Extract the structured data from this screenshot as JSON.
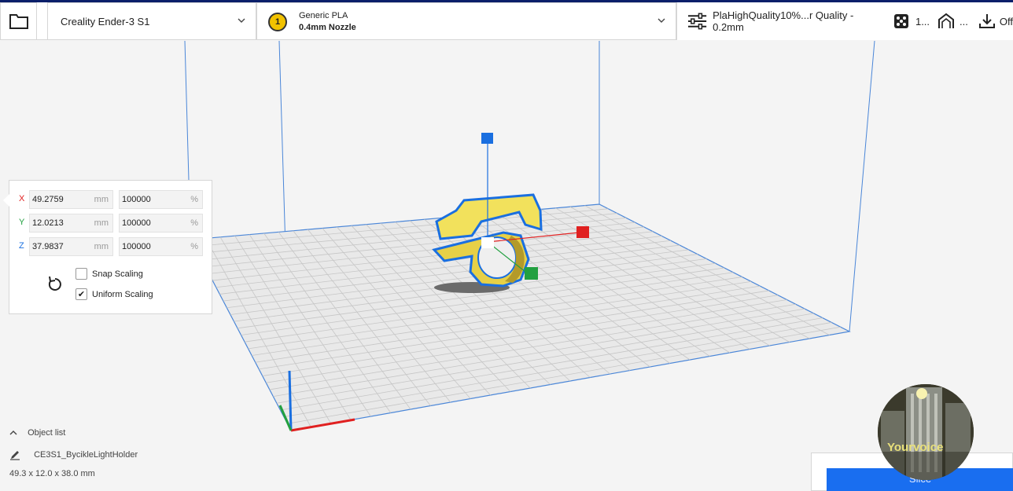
{
  "toolbar": {
    "printer_name": "Creality Ender-3 S1",
    "material": {
      "extruder_number": "1",
      "name": "Generic PLA",
      "nozzle": "0.4mm Nozzle"
    },
    "print_settings": {
      "profile": "PlaHighQuality10%...r Quality - 0.2mm",
      "support_value": "1...",
      "adhesion_value": "...",
      "adhesion_state": "Off"
    }
  },
  "scale_tool": {
    "x": {
      "axis": "X",
      "mm": "49.2759",
      "unit_mm": "mm",
      "percent": "100000",
      "unit_pct": "%"
    },
    "y": {
      "axis": "Y",
      "mm": "12.0213",
      "unit_mm": "mm",
      "percent": "100000",
      "unit_pct": "%"
    },
    "z": {
      "axis": "Z",
      "mm": "37.9837",
      "unit_mm": "mm",
      "percent": "100000",
      "unit_pct": "%"
    },
    "snap_scaling": {
      "label": "Snap Scaling",
      "checked": false
    },
    "uniform_scaling": {
      "label": "Uniform Scaling",
      "checked": true
    }
  },
  "object_list": {
    "header": "Object list",
    "object_name": "CE3S1_BycikleLightHolder",
    "dimensions": "49.3 x 12.0 x 38.0 mm"
  },
  "slice_panel": {
    "button_label": "Slice"
  },
  "webcam_overlay": {
    "text": "Yourvoice"
  },
  "colors": {
    "accent_blue": "#196ef0",
    "axis_x": "#e02020",
    "axis_y": "#22a040",
    "axis_z": "#1a6fe0",
    "model_yellow": "#f5e35a"
  }
}
